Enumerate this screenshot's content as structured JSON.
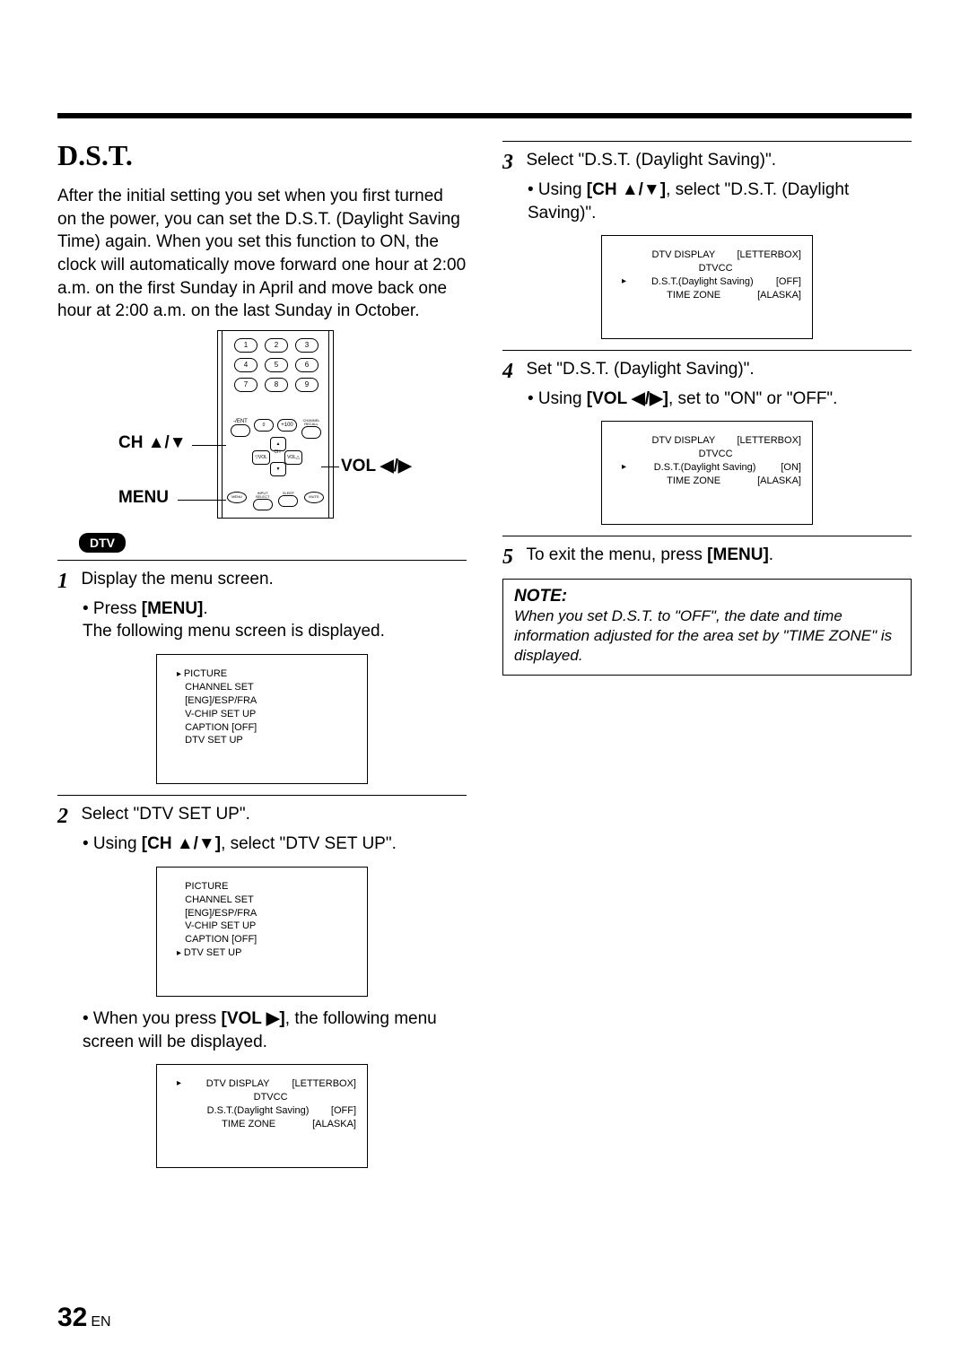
{
  "page_number": "32",
  "page_lang": "EN",
  "title": "D.S.T.",
  "intro": "After the initial setting you set when you first turned on the power, you can set the D.S.T. (Daylight Saving Time) again. When you set this function to ON, the clock will automatically move forward one hour at 2:00 a.m. on the first Sunday in April and move back one hour at 2:00 a.m. on the last Sunday in October.",
  "remote": {
    "label_ch": "CH ▲/▼",
    "label_menu": "MENU",
    "label_vol": "VOL ◀/▶",
    "num_buttons": [
      "1",
      "2",
      "3",
      "4",
      "5",
      "6",
      "7",
      "8",
      "9"
    ],
    "row4_left": "-/ENT",
    "row4_mid": "0",
    "row4_right": "+100",
    "row4_recall": "CHANNEL RECALL",
    "pad_ch": "CH",
    "pad_vol_l": "▽VOL",
    "pad_vol_r": "VOL△",
    "bottom": {
      "menu": "MENU",
      "input": "INPUT SELECT",
      "sleep": "SLEEP",
      "mute": "MUTE"
    }
  },
  "dtv_badge": "DTV",
  "steps": {
    "s1": {
      "num": "1",
      "title": "Display the menu screen.",
      "bullet_pre": "• Press ",
      "bullet_bold": "[MENU]",
      "bullet_post": ".",
      "after": "The following menu screen is displayed."
    },
    "s2": {
      "num": "2",
      "title": "Select \"DTV SET UP\".",
      "bullet_pre": "• Using ",
      "bullet_bold": "[CH ▲/▼]",
      "bullet_post": ", select \"DTV SET UP\".",
      "after_pre": "• When you press ",
      "after_bold": "[VOL ▶]",
      "after_post": ", the following menu screen will be displayed."
    },
    "s3": {
      "num": "3",
      "title": "Select \"D.S.T. (Daylight Saving)\".",
      "bullet_pre": "• Using ",
      "bullet_bold": "[CH ▲/▼]",
      "bullet_post": ", select \"D.S.T. (Daylight Saving)\"."
    },
    "s4": {
      "num": "4",
      "title": "Set \"D.S.T. (Daylight Saving)\".",
      "bullet_pre": "• Using ",
      "bullet_bold": "[VOL ◀/▶]",
      "bullet_post": ", set to \"ON\" or \"OFF\"."
    },
    "s5": {
      "num": "5",
      "title_pre": "To exit the menu, press ",
      "title_bold": "[MENU]",
      "title_post": "."
    }
  },
  "osd_menu1": {
    "items": [
      "PICTURE",
      "CHANNEL SET",
      "[ENG]/ESP/FRA",
      "V-CHIP SET UP",
      "CAPTION [OFF]",
      "DTV SET UP"
    ],
    "cursor_index": 0
  },
  "osd_menu2": {
    "items": [
      "PICTURE",
      "CHANNEL SET",
      "[ENG]/ESP/FRA",
      "V-CHIP SET UP",
      "CAPTION [OFF]",
      "DTV SET UP"
    ],
    "cursor_index": 5
  },
  "osd_dtv_off_top": {
    "rows": [
      {
        "l": "DTV DISPLAY",
        "r": "[LETTERBOX]",
        "cursor": true
      },
      {
        "l": "DTVCC",
        "r": ""
      },
      {
        "l": "D.S.T.(Daylight Saving)",
        "r": "[OFF]"
      },
      {
        "l": "TIME ZONE",
        "r": "[ALASKA]"
      }
    ]
  },
  "osd_dtv_dst_off": {
    "rows": [
      {
        "l": "DTV DISPLAY",
        "r": "[LETTERBOX]"
      },
      {
        "l": "DTVCC",
        "r": ""
      },
      {
        "l": "D.S.T.(Daylight Saving)",
        "r": "[OFF]",
        "cursor": true
      },
      {
        "l": "TIME ZONE",
        "r": "[ALASKA]"
      }
    ]
  },
  "osd_dtv_dst_on": {
    "rows": [
      {
        "l": "DTV DISPLAY",
        "r": "[LETTERBOX]"
      },
      {
        "l": "DTVCC",
        "r": ""
      },
      {
        "l": "D.S.T.(Daylight Saving)",
        "r": "[ON]",
        "cursor": true
      },
      {
        "l": "TIME ZONE",
        "r": "[ALASKA]"
      }
    ]
  },
  "note": {
    "title": "NOTE:",
    "body": "When you set D.S.T. to \"OFF\", the date and time information adjusted for the area set by \"TIME ZONE\" is displayed."
  }
}
